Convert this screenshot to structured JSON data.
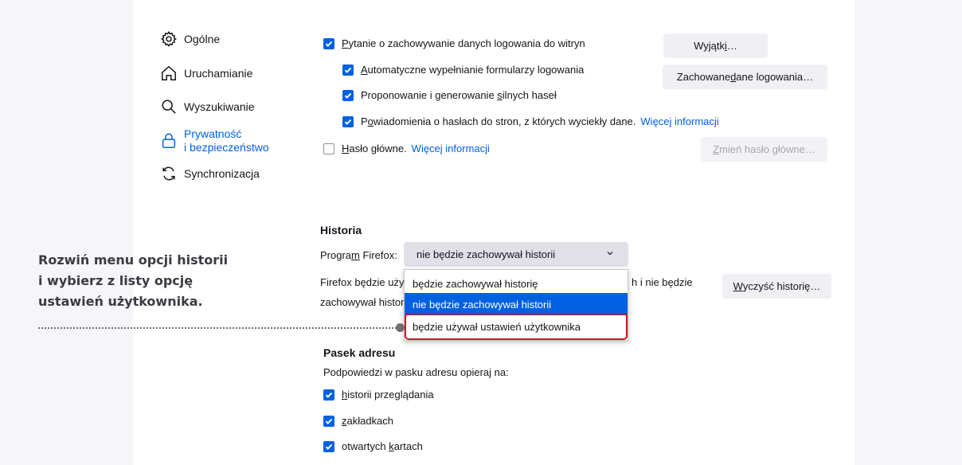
{
  "sidebar": {
    "items": [
      {
        "label": "Ogólne",
        "icon": "gear-icon"
      },
      {
        "label": "Uruchamianie",
        "icon": "home-icon"
      },
      {
        "label": "Wyszukiwanie",
        "icon": "search-icon"
      },
      {
        "label_line1": "Prywatność",
        "label_line2": "i bezpieczeństwo",
        "icon": "lock-icon",
        "active": true
      },
      {
        "label": "Synchronizacja",
        "icon": "sync-icon"
      }
    ]
  },
  "logins": {
    "ask_save": {
      "checked": true,
      "label_pre": "",
      "label_u": "P",
      "label_post": "ytanie o zachowywanie danych logowania do witryn"
    },
    "autofill": {
      "checked": true,
      "label_u": "A",
      "label_post": "utomatyczne wypełnianie formularzy logowania"
    },
    "suggest": {
      "checked": true,
      "label_pre": "Proponowanie i generowanie ",
      "label_u": "s",
      "label_post": "ilnych haseł"
    },
    "breach": {
      "checked": true,
      "label_pre": "P",
      "label_u": "o",
      "label_post": "wiadomienia o hasłach do stron, z których wyciekły dane.",
      "link": "Więcej informacji"
    },
    "master": {
      "checked": false,
      "label_u": "H",
      "label_post": "asło główne.",
      "link": "Więcej informacji"
    },
    "exceptions_button": {
      "pre": "Wyjątk",
      "u": "i",
      "post": "…"
    },
    "saved_logins_button": {
      "pre": "Zachowane ",
      "u": "d",
      "post": "ane logowania…"
    },
    "change_master_button": {
      "u": "Z",
      "post": "mień hasło główne…"
    }
  },
  "history": {
    "heading": "Historia",
    "program_label_pre": "Progra",
    "program_label_u": "m",
    "program_label_post": " Firefox:",
    "selected": "nie będzie zachowywał historii",
    "description_left1": "Firefox będzie uży",
    "description_right1": "h i nie będzie",
    "description_left2": "zachowywał histor",
    "clear_button": {
      "u": "W",
      "post": "yczyść historię…"
    },
    "options": [
      "będzie zachowywał historię",
      "nie będzie zachowywał historii",
      "będzie używał ustawień użytkownika"
    ]
  },
  "address_bar": {
    "heading": "Pasek adresu",
    "subtitle": "Podpowiedzi w pasku adresu opieraj na:",
    "items": [
      {
        "checked": true,
        "u": "h",
        "post": "istorii przeglądania"
      },
      {
        "checked": true,
        "u": "z",
        "post": "akładkach"
      },
      {
        "checked": true,
        "pre": "otwartych ",
        "u": "k",
        "post": "artach"
      }
    ]
  },
  "callout": {
    "line1": "Rozwiń menu opcji historii",
    "line2": "i wybierz z listy opcję",
    "line3": "ustawień użytkownika."
  },
  "colors": {
    "accent": "#0061e0",
    "highlight": "#d0131b"
  }
}
